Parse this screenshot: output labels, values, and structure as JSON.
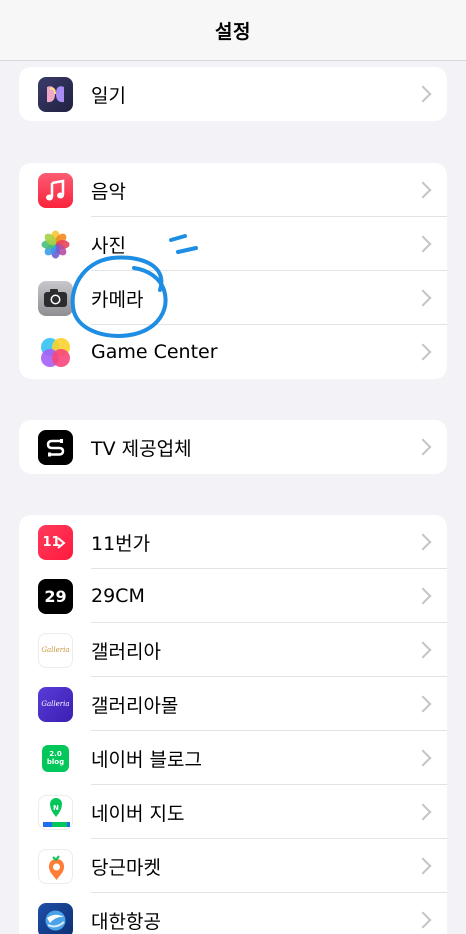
{
  "header": {
    "title": "설정"
  },
  "groups": [
    {
      "rows": [
        {
          "label": "일기",
          "icon": "journal-icon"
        }
      ]
    },
    {
      "rows": [
        {
          "label": "음악",
          "icon": "music-icon"
        },
        {
          "label": "사진",
          "icon": "photos-icon"
        },
        {
          "label": "카메라",
          "icon": "camera-icon"
        },
        {
          "label": "Game Center",
          "icon": "game-center-icon"
        }
      ]
    },
    {
      "rows": [
        {
          "label": "TV 제공업체",
          "icon": "tv-provider-icon"
        }
      ]
    },
    {
      "rows": [
        {
          "label": "11번가",
          "icon": "11st-icon",
          "badge": "11"
        },
        {
          "label": "29CM",
          "icon": "29cm-icon",
          "badge": "29"
        },
        {
          "label": "갤러리아",
          "icon": "galleria-icon",
          "badge": "Galleria"
        },
        {
          "label": "갤러리아몰",
          "icon": "galleria-mall-icon",
          "badge": "Galleria"
        },
        {
          "label": "네이버 블로그",
          "icon": "naver-blog-icon",
          "badge": "2.0 blog"
        },
        {
          "label": "네이버 지도",
          "icon": "naver-map-icon",
          "badge": "N"
        },
        {
          "label": "당근마켓",
          "icon": "daangn-icon"
        },
        {
          "label": "대한항공",
          "icon": "korean-air-icon"
        }
      ]
    }
  ]
}
